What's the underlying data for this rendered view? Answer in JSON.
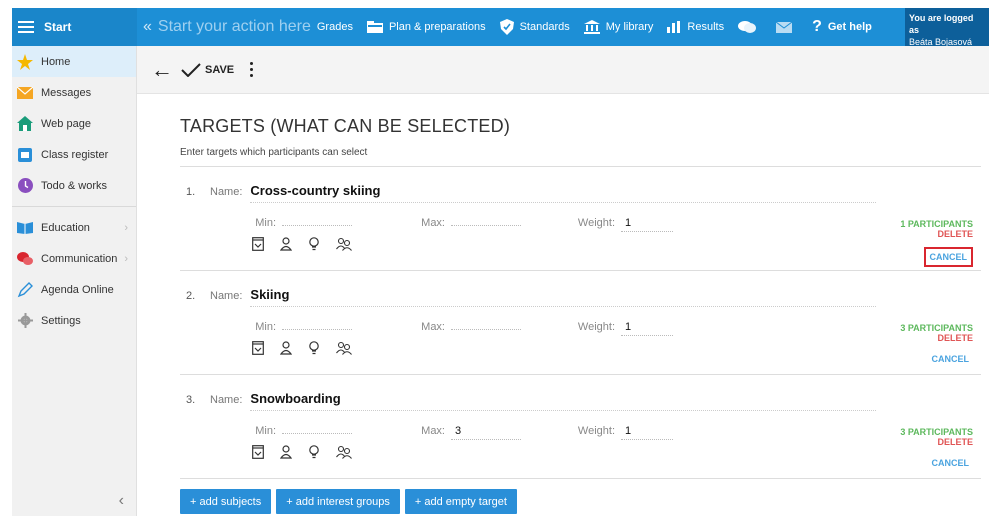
{
  "topbar": {
    "start": "Start",
    "action_placeholder": "Start your action here",
    "nav": [
      {
        "label": "Grades",
        "icon": "none"
      },
      {
        "label": "Plan & preparations",
        "icon": "folder-icon"
      },
      {
        "label": "Standards",
        "icon": "shield-icon"
      },
      {
        "label": "My library",
        "icon": "library-icon"
      },
      {
        "label": "Results",
        "icon": "bar-chart-icon"
      }
    ],
    "help": "Get help",
    "logged_label": "You are logged as",
    "user": "Beáta Bojasová"
  },
  "sidebar": {
    "items": [
      {
        "label": "Home",
        "icon": "star-icon"
      },
      {
        "label": "Messages",
        "icon": "envelope-icon"
      },
      {
        "label": "Web page",
        "icon": "house-icon"
      },
      {
        "label": "Class register",
        "icon": "register-icon"
      },
      {
        "label": "Todo & works",
        "icon": "clock-icon"
      },
      {
        "label": "Education",
        "icon": "book-icon"
      },
      {
        "label": "Communication",
        "icon": "chat-icon"
      },
      {
        "label": "Agenda Online",
        "icon": "pen-icon"
      },
      {
        "label": "Settings",
        "icon": "gear-icon"
      }
    ]
  },
  "toolbar": {
    "save": "SAVE"
  },
  "main": {
    "title": "TARGETS (WHAT CAN BE SELECTED)",
    "subtitle": "Enter targets which participants can select",
    "labels": {
      "name": "Name:",
      "min": "Min:",
      "max": "Max:",
      "weight": "Weight:"
    },
    "targets": [
      {
        "num": "1.",
        "name": "Cross-country skiing",
        "min": "",
        "max": "",
        "weight": "1",
        "participants": "1 PARTICIPANTS",
        "delete": "DELETE",
        "cancel": "CANCEL"
      },
      {
        "num": "2.",
        "name": "Skiing",
        "min": "",
        "max": "",
        "weight": "1",
        "participants": "3 PARTICIPANTS",
        "delete": "DELETE",
        "cancel": "CANCEL"
      },
      {
        "num": "3.",
        "name": "Snowboarding",
        "min": "",
        "max": "3",
        "weight": "1",
        "participants": "3 PARTICIPANTS",
        "delete": "DELETE",
        "cancel": "CANCEL"
      }
    ],
    "buttons": {
      "subjects": "+ add subjects",
      "interest": "+ add interest groups",
      "empty": "+ add empty target"
    }
  },
  "colors": {
    "accent": "#1d8fd6",
    "participants": "#5cb85c",
    "delete": "#e05555",
    "cancel": "#4aa3df"
  }
}
